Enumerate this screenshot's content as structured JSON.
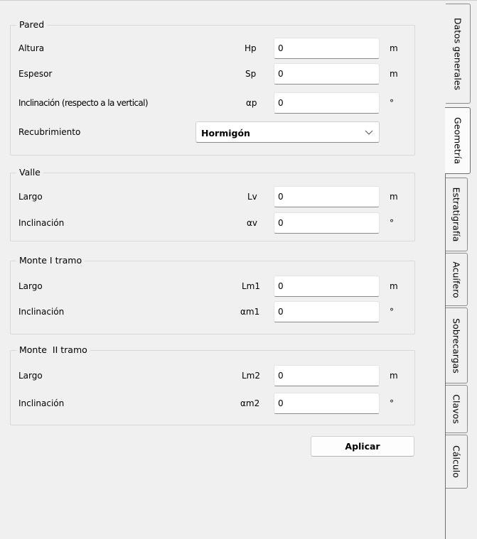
{
  "groups": {
    "pared": {
      "title": "Pared",
      "rows": [
        {
          "label": "Altura",
          "symbol": "Hp",
          "value": "0",
          "unit": "m"
        },
        {
          "label": "Espesor",
          "symbol": "Sp",
          "value": "0",
          "unit": "m"
        },
        {
          "label": "Inclinación (respecto a la vertical)",
          "symbol": "αp",
          "value": "0",
          "unit": "°"
        }
      ],
      "recubrimiento": {
        "label": "Recubrimiento",
        "selected": "Hormigón"
      }
    },
    "valle": {
      "title": "Valle",
      "rows": [
        {
          "label": "Largo",
          "symbol": "Lv",
          "value": "0",
          "unit": "m"
        },
        {
          "label": "Inclinación",
          "symbol": "αv",
          "value": "0",
          "unit": "°"
        }
      ]
    },
    "monte1": {
      "title": "Monte I tramo",
      "rows": [
        {
          "label": "Largo",
          "symbol": "Lm1",
          "value": "0",
          "unit": "m"
        },
        {
          "label": "Inclinación",
          "symbol": "αm1",
          "value": "0",
          "unit": "°"
        }
      ]
    },
    "monte2": {
      "title": "Monte  II tramo",
      "rows": [
        {
          "label": "Largo",
          "symbol": "Lm2",
          "value": "0",
          "unit": "m"
        },
        {
          "label": "Inclinación",
          "symbol": "αm2",
          "value": "0",
          "unit": "°"
        }
      ]
    }
  },
  "apply_label": "Aplicar",
  "tabs": [
    {
      "label": "Datos generales",
      "active": false
    },
    {
      "label": "Geometría",
      "active": true
    },
    {
      "label": "Estratigrafía",
      "active": false
    },
    {
      "label": "Acuífero",
      "active": false
    },
    {
      "label": "Sobrecargas",
      "active": false
    },
    {
      "label": "Clavos",
      "active": false
    },
    {
      "label": "Cálculo",
      "active": false
    }
  ],
  "icons": {
    "combo_arrow": "chevron-down-icon"
  }
}
